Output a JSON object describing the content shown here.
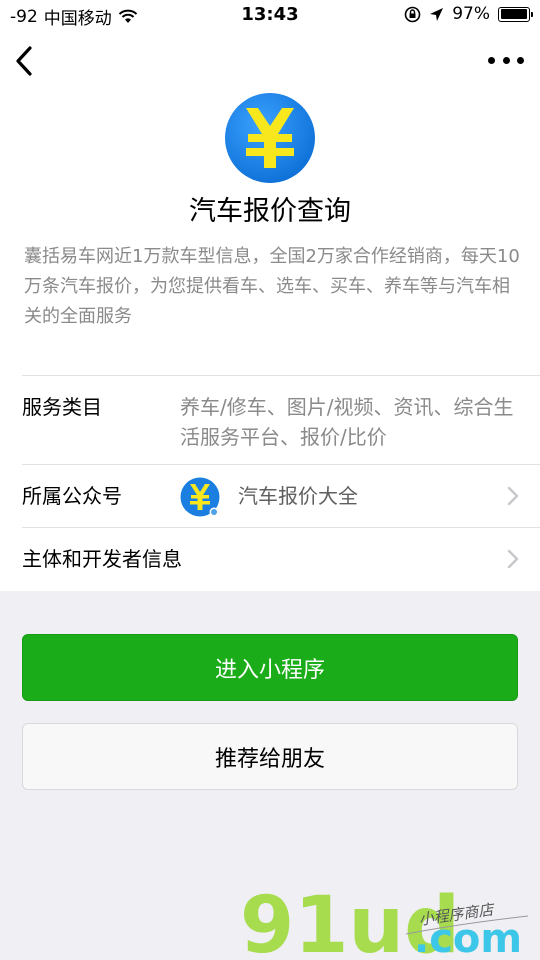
{
  "status_bar": {
    "signal": "-92",
    "carrier": "中国移动",
    "time": "13:43",
    "battery": "97%",
    "battery_level": 0.97
  },
  "nav": {
    "back_icon": "chevron-left-icon",
    "more_icon": "more-dots-icon"
  },
  "app": {
    "logo_icon": "yuan-coin-icon",
    "title": "汽车报价查询",
    "description": "囊括易车网近1万款车型信息，全国2万家合作经销商，每天10万条汽车报价，为您提供看车、选车、买车、养车等与汽车相关的全面服务"
  },
  "info": {
    "service_label": "服务类目",
    "service_value": "养车/修车、图片/视频、资讯、综合生活服务平台、报价/比价",
    "account_label": "所属公众号",
    "account_name": "汽车报价大全",
    "developer_label": "主体和开发者信息"
  },
  "buttons": {
    "enter": "进入小程序",
    "share": "推荐给朋友"
  },
  "watermark": {
    "brand": "91ud",
    "domain": ".com",
    "tagline": "小程序商店"
  },
  "colors": {
    "primary_green": "#1aad19",
    "logo_blue": "#1a7fe0",
    "logo_yellow": "#f8e71c",
    "watermark_green": "#a6dc4e",
    "watermark_cyan": "#3cc6e8"
  }
}
